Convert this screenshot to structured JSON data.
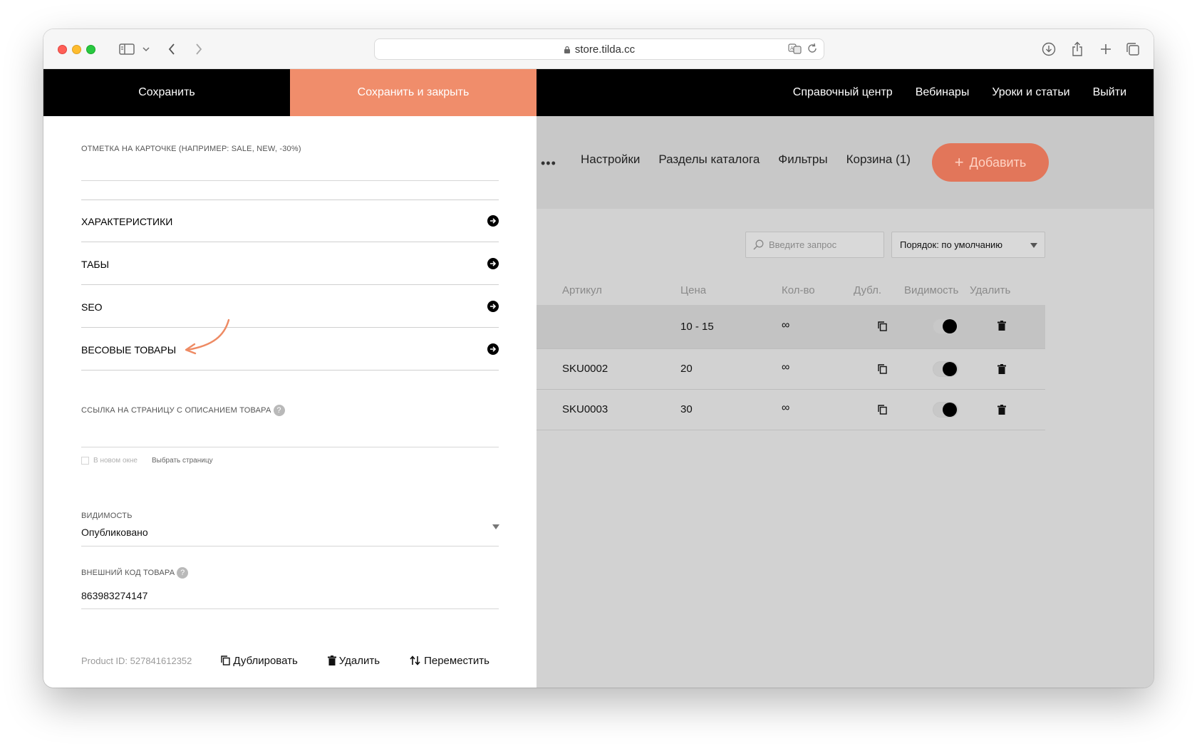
{
  "browser": {
    "url": "store.tilda.cc"
  },
  "topbar": {
    "save_label": "Сохранить",
    "save_close_label": "Сохранить и закрыть",
    "links": [
      "Справочный центр",
      "Вебинары",
      "Уроки и статьи",
      "Выйти"
    ],
    "accent_color": "#f08d6b"
  },
  "editor": {
    "mark_label": "ОТМЕТКА НА КАРТОЧКЕ (НАПРИМЕР: SALE, NEW, -30%)",
    "mark_value": "",
    "sections": [
      "ХАРАКТЕРИСТИКИ",
      "ТАБЫ",
      "SEO",
      "ВЕСОВЫЕ ТОВАРЫ"
    ],
    "link_label": "ССЫЛКА НА СТРАНИЦУ С ОПИСАНИЕМ ТОВАРА",
    "link_value": "",
    "new_window_label": "В новом окне",
    "choose_page_label": "Выбрать страницу",
    "visibility_label": "ВИДИМОСТЬ",
    "visibility_value": "Опубликовано",
    "external_code_label": "ВНЕШНИЙ КОД ТОВАРА",
    "external_code_value": "863983274147",
    "product_id": "Product ID: 527841612352",
    "duplicate_label": "Дублировать",
    "delete_label": "Удалить",
    "move_label": "Переместить"
  },
  "catalog": {
    "tabs": [
      "Настройки",
      "Разделы каталога",
      "Фильтры",
      "Корзина (1)"
    ],
    "add_label": "Добавить",
    "search_placeholder": "Введите запрос",
    "sort_label": "Порядок: по умолчанию",
    "columns": [
      "Артикул",
      "Цена",
      "Кол-во",
      "Дубл.",
      "Видимость",
      "Удалить"
    ],
    "rows": [
      {
        "sku": "",
        "price": "10 - 15",
        "qty": "∞",
        "visible": true
      },
      {
        "sku": "SKU0002",
        "price": "20",
        "qty": "∞",
        "visible": true
      },
      {
        "sku": "SKU0003",
        "price": "30",
        "qty": "∞",
        "visible": true
      }
    ]
  }
}
